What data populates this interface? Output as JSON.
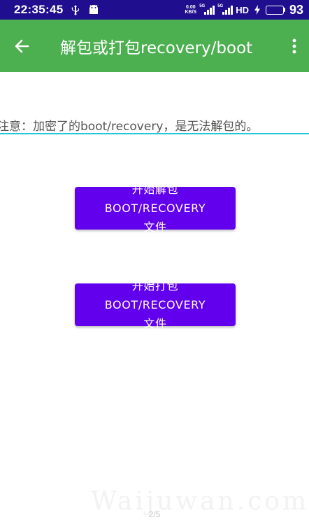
{
  "status_bar": {
    "time": "22:35:45",
    "net_speed_value": "0.00",
    "net_speed_unit": "KB/S",
    "signal1_tag": "5G",
    "signal2_tag": "5G",
    "hd_label": "HD",
    "battery_percent": "93",
    "battery_level": 0.93,
    "battery_color": "#4cd964"
  },
  "app_bar": {
    "title": "解包或打包recovery/boot",
    "back_icon": "arrow-back-icon",
    "menu_icon": "more-vertical-icon",
    "color": "#4caf50"
  },
  "notice": {
    "text": "注意：加密了的boot/recovery，是无法解包的。"
  },
  "buttons": {
    "unpack_label": "开始解包BOOT/RECOVERY文件",
    "pack_label": "开始打包BOOT/RECOVERY文件",
    "color": "#6200ee"
  },
  "watermark": "Waijuwan.com",
  "page_indicator": "2/5"
}
